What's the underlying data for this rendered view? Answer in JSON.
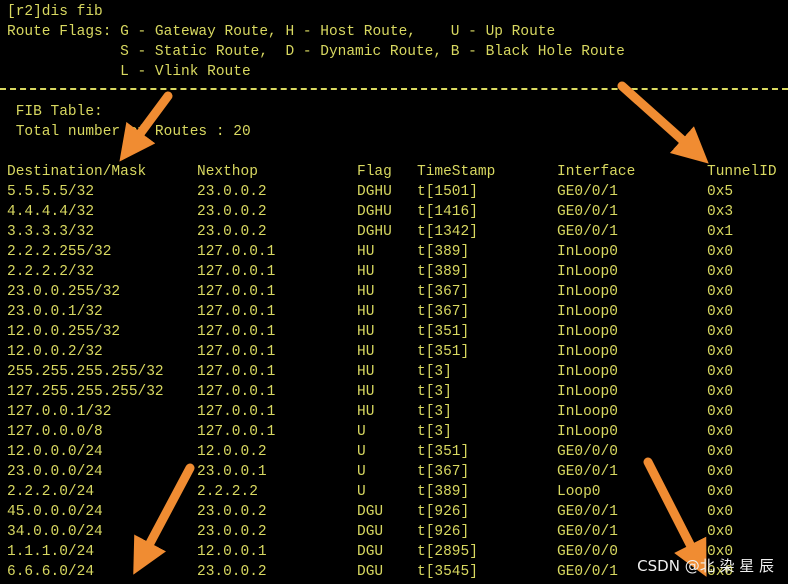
{
  "terminal": {
    "prompt_line": "[r2]dis fib",
    "flags_line1": "Route Flags: G - Gateway Route, H - Host Route,    U - Up Route",
    "flags_line2": "             S - Static Route,  D - Dynamic Route, B - Black Hole Route",
    "flags_line3": "             L - Vlink Route",
    "fib_title": " FIB Table:",
    "total_routes": " Total number of Routes : 20"
  },
  "table": {
    "headers": [
      "Destination/Mask",
      "Nexthop",
      "Flag",
      "TimeStamp",
      "Interface",
      "TunnelID"
    ],
    "rows": [
      [
        "5.5.5.5/32",
        "23.0.0.2",
        "DGHU",
        "t[1501]",
        "GE0/0/1",
        "0x5"
      ],
      [
        "4.4.4.4/32",
        "23.0.0.2",
        "DGHU",
        "t[1416]",
        "GE0/0/1",
        "0x3"
      ],
      [
        "3.3.3.3/32",
        "23.0.0.2",
        "DGHU",
        "t[1342]",
        "GE0/0/1",
        "0x1"
      ],
      [
        "2.2.2.255/32",
        "127.0.0.1",
        "HU",
        "t[389]",
        "InLoop0",
        "0x0"
      ],
      [
        "2.2.2.2/32",
        "127.0.0.1",
        "HU",
        "t[389]",
        "InLoop0",
        "0x0"
      ],
      [
        "23.0.0.255/32",
        "127.0.0.1",
        "HU",
        "t[367]",
        "InLoop0",
        "0x0"
      ],
      [
        "23.0.0.1/32",
        "127.0.0.1",
        "HU",
        "t[367]",
        "InLoop0",
        "0x0"
      ],
      [
        "12.0.0.255/32",
        "127.0.0.1",
        "HU",
        "t[351]",
        "InLoop0",
        "0x0"
      ],
      [
        "12.0.0.2/32",
        "127.0.0.1",
        "HU",
        "t[351]",
        "InLoop0",
        "0x0"
      ],
      [
        "255.255.255.255/32",
        "127.0.0.1",
        "HU",
        "t[3]",
        "InLoop0",
        "0x0"
      ],
      [
        "127.255.255.255/32",
        "127.0.0.1",
        "HU",
        "t[3]",
        "InLoop0",
        "0x0"
      ],
      [
        "127.0.0.1/32",
        "127.0.0.1",
        "HU",
        "t[3]",
        "InLoop0",
        "0x0"
      ],
      [
        "127.0.0.0/8",
        "127.0.0.1",
        "U",
        "t[3]",
        "InLoop0",
        "0x0"
      ],
      [
        "12.0.0.0/24",
        "12.0.0.2",
        "U",
        "t[351]",
        "GE0/0/0",
        "0x0"
      ],
      [
        "23.0.0.0/24",
        "23.0.0.1",
        "U",
        "t[367]",
        "GE0/0/1",
        "0x0"
      ],
      [
        "2.2.2.0/24",
        "2.2.2.2",
        "U",
        "t[389]",
        "Loop0",
        "0x0"
      ],
      [
        "45.0.0.0/24",
        "23.0.0.2",
        "DGU",
        "t[926]",
        "GE0/0/1",
        "0x0"
      ],
      [
        "34.0.0.0/24",
        "23.0.0.2",
        "DGU",
        "t[926]",
        "GE0/0/1",
        "0x0"
      ],
      [
        "1.1.1.0/24",
        "12.0.0.1",
        "DGU",
        "t[2895]",
        "GE0/0/0",
        "0x0"
      ],
      [
        "6.6.6.0/24",
        "23.0.0.2",
        "DGU",
        "t[3545]",
        "GE0/0/1",
        "0x0"
      ]
    ]
  },
  "watermark": "CSDN @北 染 星 辰",
  "colors": {
    "background": "#000000",
    "terminal_text": "#d8d860",
    "annotation_arrow": "#f08c32",
    "watermark": "#f0f0f0"
  }
}
